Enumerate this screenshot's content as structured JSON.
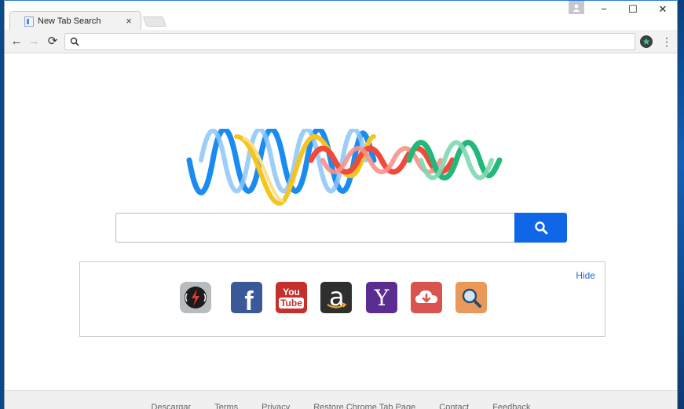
{
  "browser": {
    "tab_title": "New Tab Search",
    "tab_close": "×",
    "window_controls": {
      "minimize": "−",
      "maximize": "☐",
      "close": "✕"
    },
    "omnibox_value": "",
    "nav": {
      "back": "←",
      "forward": "→",
      "reload": "⟳"
    },
    "menu": "⋮"
  },
  "page": {
    "search_placeholder": "",
    "hide_label": "Hide",
    "shortcuts": [
      {
        "name": "radio",
        "color": "#b9bcbf"
      },
      {
        "name": "facebook",
        "color": "#3b5998"
      },
      {
        "name": "youtube",
        "color": "#c4302b"
      },
      {
        "name": "amazon",
        "color": "#2f2f2f"
      },
      {
        "name": "yahoo",
        "color": "#5c2d91"
      },
      {
        "name": "download",
        "color": "#d9534f"
      },
      {
        "name": "search",
        "color": "#e99a5a"
      }
    ],
    "youtube_text": {
      "top": "You",
      "bottom": "Tube"
    },
    "yahoo_text": "Y",
    "amazon_text": "a",
    "facebook_text": "f",
    "footer_links": [
      "Descargar",
      "Terms",
      "Privacy",
      "Restore Chrome Tab Page",
      "Contact",
      "Feedback"
    ]
  },
  "colors": {
    "search_button": "#0f66e6",
    "link": "#2a66c9",
    "wave_blue": "#1a8cf0",
    "wave_yellow": "#f5c420",
    "wave_red": "#f04a3a",
    "wave_green": "#22b87a"
  }
}
